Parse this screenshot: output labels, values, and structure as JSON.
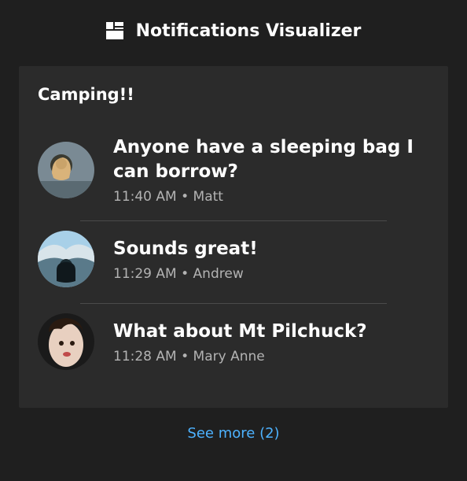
{
  "header": {
    "title": "Notifications Visualizer"
  },
  "card": {
    "title": "Camping!!"
  },
  "messages": [
    {
      "title": "Anyone have a sleeping bag I can borrow?",
      "time": "11:40 AM",
      "sender": "Matt"
    },
    {
      "title": "Sounds great!",
      "time": "11:29 AM",
      "sender": "Andrew"
    },
    {
      "title": "What about Mt Pilchuck?",
      "time": "11:28 AM",
      "sender": "Mary Anne"
    }
  ],
  "see_more": {
    "label": "See more (2)",
    "count": 2
  }
}
